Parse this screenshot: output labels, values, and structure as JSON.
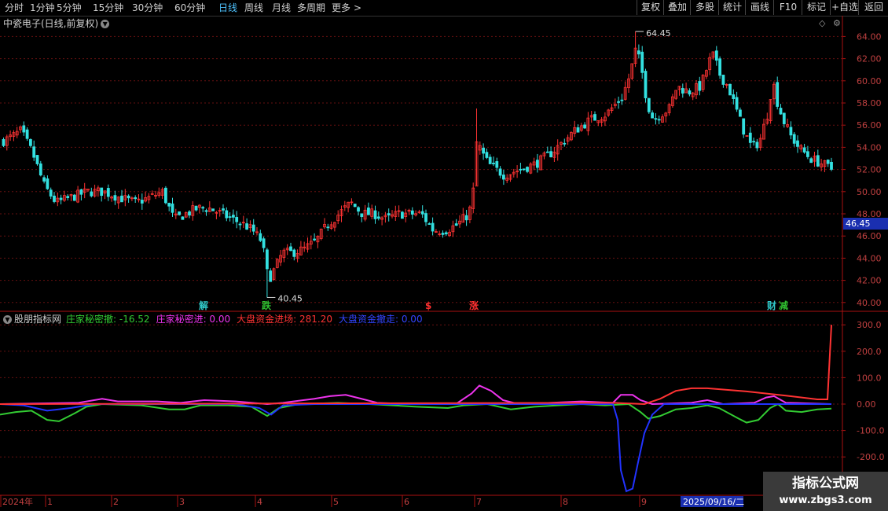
{
  "toolbar": {
    "periods": [
      {
        "label": "分时",
        "active": false
      },
      {
        "label": "1分钟",
        "active": false
      },
      {
        "label": "5分钟",
        "active": false
      },
      {
        "label": "15分钟",
        "active": false
      },
      {
        "label": "30分钟",
        "active": false
      },
      {
        "label": "60分钟",
        "active": false
      },
      {
        "label": "日线",
        "active": true
      },
      {
        "label": "周线",
        "active": false
      },
      {
        "label": "月线",
        "active": false
      },
      {
        "label": "多周期",
        "active": false
      },
      {
        "label": "更多",
        "active": false
      }
    ],
    "more_chevron": ">",
    "buttons": [
      "复权",
      "叠加",
      "多股",
      "统计",
      "画线",
      "F10",
      "标记",
      "+自选",
      "返回"
    ]
  },
  "main_panel": {
    "title": "中瓷电子(日线,前复权)",
    "price_axis": [
      "64.00",
      "62.00",
      "60.00",
      "58.00",
      "56.00",
      "54.00",
      "52.00",
      "50.00",
      "48.00",
      "46.00",
      "44.00",
      "42.00",
      "40.00"
    ],
    "current_price_tag": "46.45",
    "high_label": "64.45",
    "low_label": "40.45",
    "signal_markers": [
      {
        "text": "解",
        "color": "#30c8c8"
      },
      {
        "text": "跌",
        "color": "#30c030"
      },
      {
        "text": "$",
        "color": "#ff3030"
      },
      {
        "text": "涨",
        "color": "#ff3030"
      },
      {
        "text": "财",
        "color": "#30c8c8"
      },
      {
        "text": "减",
        "color": "#30c030"
      }
    ]
  },
  "indicator_panel": {
    "name": "股朋指标网",
    "labels": [
      {
        "text": "庄家秘密撤: -16.52",
        "color": "#33cc33"
      },
      {
        "text": "庄家秘密进: 0.00",
        "color": "#ee33ee"
      },
      {
        "text": "大盘资金进场: 281.20",
        "color": "#ff3333"
      },
      {
        "text": "大盘资金撤走: 0.00",
        "color": "#3344ff"
      }
    ],
    "axis": [
      "300.0",
      "200.0",
      "100.0",
      "0.00",
      "-100.0",
      "-200.0"
    ]
  },
  "time_axis": {
    "labels": [
      "2024年",
      "1",
      "2",
      "3",
      "4",
      "5",
      "6",
      "7",
      "8",
      "9"
    ],
    "cursor_date": "2025/09/16/二"
  },
  "watermark": {
    "line1": "指标公式网",
    "line2": "www.zbgs3.com"
  },
  "colors": {
    "up": "#ff3333",
    "down": "#33e0e0",
    "grid": "#661111",
    "green": "#33cc33",
    "magenta": "#ee33ee",
    "red": "#ff3333",
    "blue": "#2233ff"
  }
}
